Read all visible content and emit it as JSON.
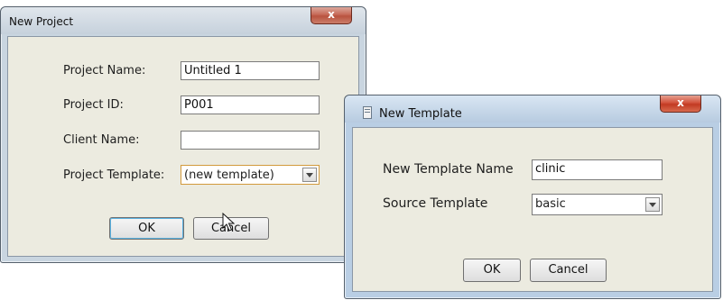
{
  "new_project": {
    "title": "New Project",
    "close_label": "x",
    "project_name_label": "Project Name:",
    "project_name_value": "Untitled 1",
    "project_id_label": "Project ID:",
    "project_id_value": "P001",
    "client_name_label": "Client Name:",
    "client_name_value": "",
    "project_template_label": "Project Template:",
    "project_template_value": "(new template)",
    "ok_label": "OK",
    "cancel_label": "Cancel"
  },
  "new_template": {
    "title": "New Template",
    "close_label": "x",
    "template_name_label": "New Template Name",
    "template_name_value": "clinic",
    "source_template_label": "Source Template",
    "source_template_value": "basic",
    "ok_label": "OK",
    "cancel_label": "Cancel"
  },
  "colors": {
    "active_frame": "#b9cee4",
    "dialog_face": "#ecebe0",
    "close_button": "#c23a22",
    "focus_border": "#d29a3c"
  }
}
